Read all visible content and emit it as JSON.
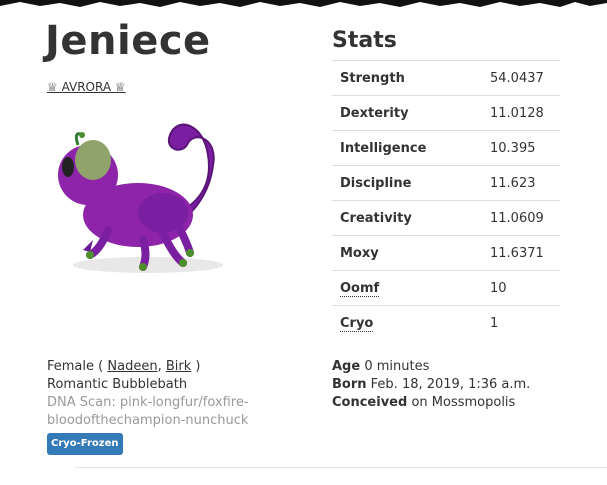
{
  "pet": {
    "name": "Jeniece",
    "house_name": "♕ AVRORA ♕",
    "gender": "Female",
    "paren_open": "(",
    "paren_close": ")",
    "parents": [
      "Nadeen",
      "Birk"
    ],
    "personality": "Romantic Bubblebath",
    "dna_scan": "DNA Scan: pink-longfur/foxfire-bloodofthechampion-nunchuck",
    "status_badge": "Cryo-Frozen"
  },
  "stats": {
    "title": "Stats",
    "rows": [
      {
        "label": "Strength",
        "value": "54.0437"
      },
      {
        "label": "Dexterity",
        "value": "11.0128"
      },
      {
        "label": "Intelligence",
        "value": "10.395"
      },
      {
        "label": "Discipline",
        "value": "11.623"
      },
      {
        "label": "Creativity",
        "value": "11.0609"
      },
      {
        "label": "Moxy",
        "value": "11.6371"
      },
      {
        "label": "Oomf",
        "value": "10"
      },
      {
        "label": "Cryo",
        "value": "1"
      }
    ]
  },
  "info": {
    "age_label": "Age",
    "age_value": "0 minutes",
    "born_label": "Born",
    "born_value": "Feb. 18, 2019, 1:36 a.m.",
    "conceived_label": "Conceived",
    "conceived_value": "on Mossmopolis"
  },
  "colors": {
    "badge": "#337ab7",
    "creature_body": "#7b1fa2",
    "creature_face": "#8fa36b"
  }
}
